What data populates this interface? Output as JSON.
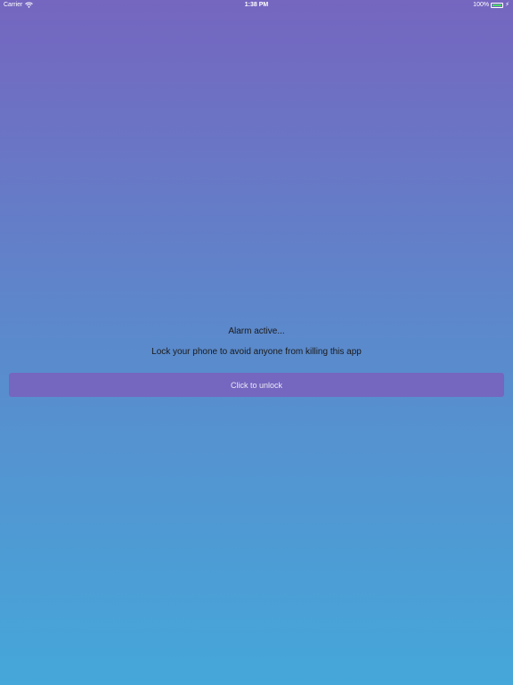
{
  "status_bar": {
    "carrier": "Carrier",
    "time": "1:38 PM",
    "battery_percent": "100%",
    "battery_level": 1.0,
    "wifi_icon": "wifi-icon",
    "battery_icon": "battery-icon",
    "charging_icon": "bolt-icon"
  },
  "main": {
    "alarm_status": "Alarm active...",
    "lock_message": "Lock your phone to avoid anyone from killing this app",
    "unlock_button_label": "Click to unlock"
  },
  "colors": {
    "gradient_top": "#7566c0",
    "gradient_bottom": "#45a7da",
    "button_background": "#7566c0",
    "battery_fill": "#4cd964"
  }
}
